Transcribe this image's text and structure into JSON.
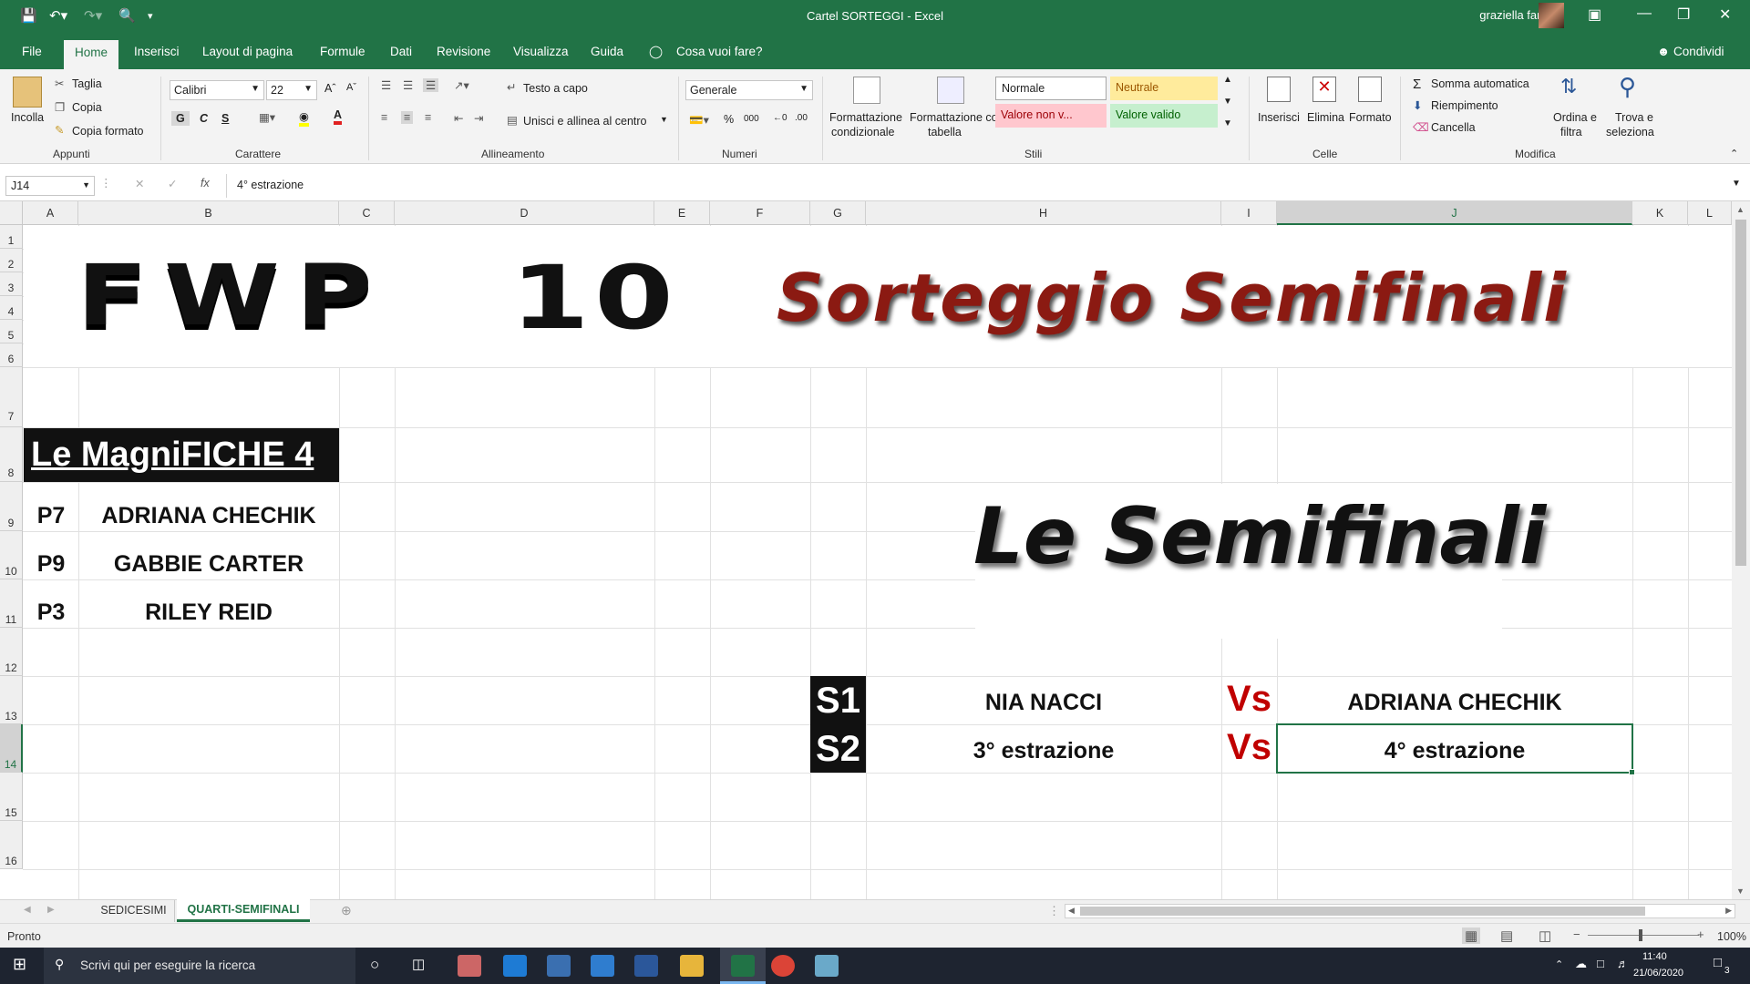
{
  "titlebar": {
    "title": "Cartel SORTEGGI  -  Excel",
    "user": "graziella fanais"
  },
  "menu": {
    "tabs": [
      "File",
      "Home",
      "Inserisci",
      "Layout di pagina",
      "Formule",
      "Dati",
      "Revisione",
      "Visualizza",
      "Guida"
    ],
    "tellme": "Cosa vuoi fare?",
    "share": "Condividi"
  },
  "ribbon": {
    "clipboard": {
      "paste": "Incolla",
      "cut": "Taglia",
      "copy": "Copia",
      "format_painter": "Copia formato",
      "group": "Appunti"
    },
    "font": {
      "name": "Calibri",
      "size": "22",
      "bold": "G",
      "italic": "C",
      "underline": "S",
      "group": "Carattere"
    },
    "alignment": {
      "wrap": "Testo a capo",
      "merge": "Unisci e allinea al centro",
      "group": "Allineamento"
    },
    "number": {
      "format": "Generale",
      "group": "Numeri"
    },
    "styles": {
      "cond_format": "Formattazione",
      "cond_format2": "condizionale",
      "format_table": "Formattazione come",
      "format_table2": "tabella",
      "normal": "Normale",
      "neutral": "Neutrale",
      "bad": "Valore non v...",
      "good": "Valore valido",
      "group": "Stili"
    },
    "cells": {
      "insert": "Inserisci",
      "delete": "Elimina",
      "format": "Formato",
      "group": "Celle"
    },
    "editing": {
      "autosum": "Somma automatica",
      "fill": "Riempimento",
      "clear": "Cancella",
      "sort": "Ordina e",
      "sort2": "filtra",
      "find": "Trova e",
      "find2": "seleziona",
      "group": "Modifica"
    }
  },
  "formula_bar": {
    "name_box": "J14",
    "fx": "fx",
    "content": "4° estrazione"
  },
  "columns": [
    "A",
    "B",
    "C",
    "D",
    "E",
    "F",
    "G",
    "H",
    "I",
    "J",
    "K",
    "L"
  ],
  "rows": [
    "1",
    "2",
    "3",
    "4",
    "5",
    "6",
    "7",
    "8",
    "9",
    "10",
    "11",
    "12",
    "13",
    "14",
    "15",
    "16"
  ],
  "sheet": {
    "art_fwp": "FWP",
    "art_10": "10",
    "art_title": "Sorteggio Semifinali",
    "art_semifinali": "Le Semifinali",
    "magnifiche_header": "Le MagniFICHE 4",
    "magnifiche": [
      {
        "code": "P7",
        "name": "ADRIANA CHECHIK"
      },
      {
        "code": "P9",
        "name": "GABBIE CARTER"
      },
      {
        "code": "P3",
        "name": "RILEY REID"
      }
    ],
    "matches": [
      {
        "label": "S1",
        "home": "NIA NACCI",
        "vs": "Vs",
        "away": "ADRIANA CHECHIK"
      },
      {
        "label": "S2",
        "home": "3° estrazione",
        "vs": "Vs",
        "away": "4° estrazione"
      }
    ]
  },
  "sheet_tabs": [
    "SEDICESIMI",
    "QUARTI-SEMIFINALI"
  ],
  "status": {
    "mode": "Pronto",
    "zoom": "100%"
  },
  "taskbar": {
    "search": "Scrivi qui per eseguire la ricerca",
    "time": "11:40",
    "date": "21/06/2020",
    "notifications": "3"
  },
  "colors": {
    "excel_green": "#217346",
    "dark_red": "#8b1a12",
    "vs_red": "#c00000"
  }
}
